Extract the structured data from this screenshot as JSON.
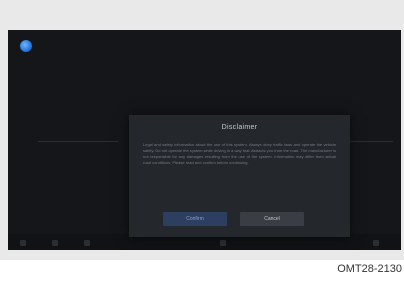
{
  "dialog": {
    "title": "Disclaimer",
    "body": "Legal and safety information about the use of this system. Always obey traffic laws and operate the vehicle safely. Do not operate the system while driving in a way that distracts you from the road. The manufacturer is not responsible for any damages resulting from the use of the system. Information may differ from actual road conditions. Please read and confirm before continuing.",
    "confirm_label": "Confirm",
    "cancel_label": "Cancel"
  },
  "caption": "OMT28-2130",
  "colors": {
    "screen_bg": "#141619",
    "dialog_bg": "#24272c",
    "confirm_button": "#2c3f60",
    "cancel_button": "#3a3d43",
    "logo_accent": "#2a7be0"
  },
  "icons": [
    "app-logo-icon"
  ]
}
